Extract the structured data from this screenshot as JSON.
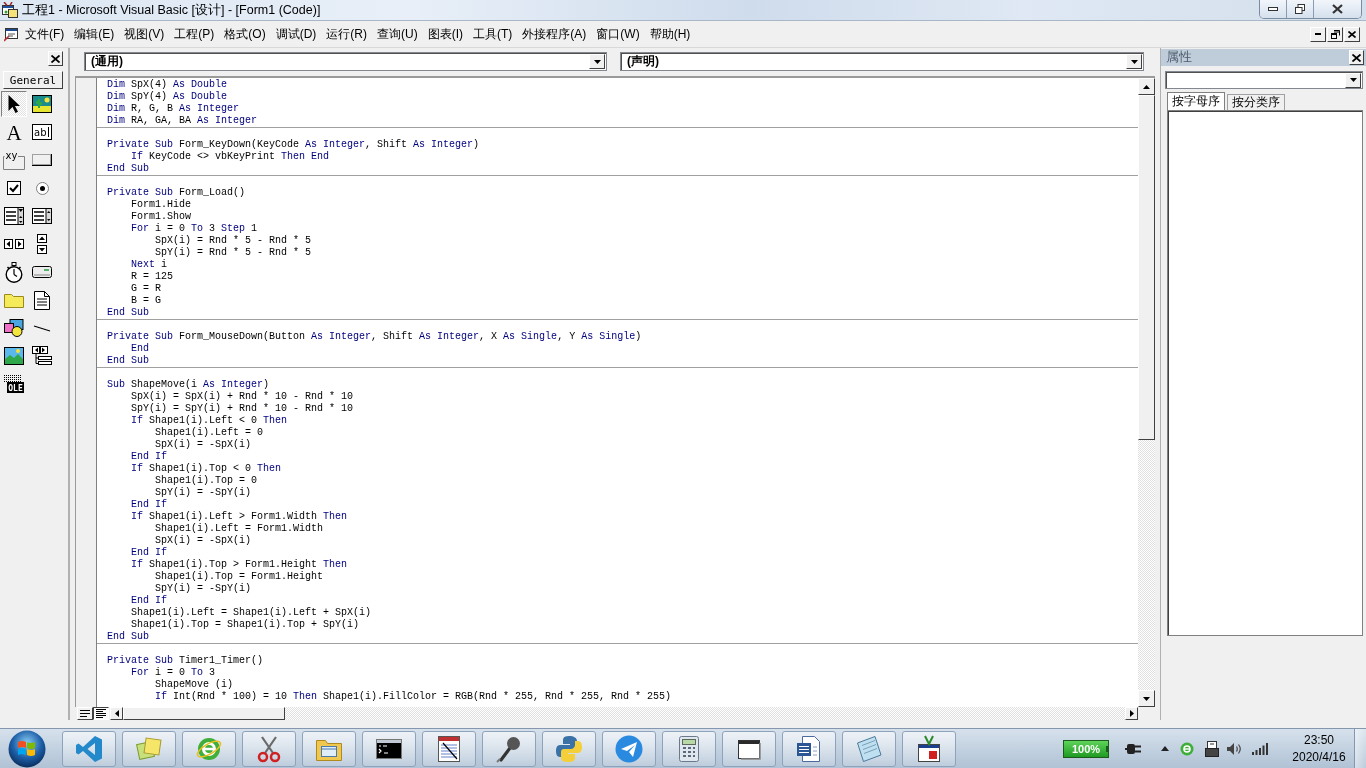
{
  "title_bar": {
    "title": "工程1 - Microsoft Visual Basic [设计] - [Form1 (Code)]"
  },
  "menu_bar": {
    "items": [
      "文件(F)",
      "编辑(E)",
      "视图(V)",
      "工程(P)",
      "格式(O)",
      "调试(D)",
      "运行(R)",
      "查询(U)",
      "图表(I)",
      "工具(T)",
      "外接程序(A)",
      "窗口(W)",
      "帮助(H)"
    ]
  },
  "toolbox": {
    "tab": "General",
    "tools": [
      {
        "kind": "pointer",
        "selected": true
      },
      {
        "kind": "picturebox",
        "selected": false
      },
      {
        "kind": "label",
        "selected": false,
        "glyph": "A"
      },
      {
        "kind": "textbox",
        "selected": false,
        "glyph": "ab"
      },
      {
        "kind": "frame",
        "selected": false,
        "glyph": "xy"
      },
      {
        "kind": "commandbutton",
        "selected": false
      },
      {
        "kind": "checkbox",
        "selected": false
      },
      {
        "kind": "optionbutton",
        "selected": false
      },
      {
        "kind": "combobox",
        "selected": false
      },
      {
        "kind": "listbox",
        "selected": false
      },
      {
        "kind": "hscroll",
        "selected": false
      },
      {
        "kind": "vscroll",
        "selected": false
      },
      {
        "kind": "timer",
        "selected": false
      },
      {
        "kind": "drivelist",
        "selected": false
      },
      {
        "kind": "dirlist",
        "selected": false
      },
      {
        "kind": "filelist",
        "selected": false
      },
      {
        "kind": "shape",
        "selected": false
      },
      {
        "kind": "line",
        "selected": false
      },
      {
        "kind": "image",
        "selected": false
      },
      {
        "kind": "data",
        "selected": false
      },
      {
        "kind": "ole",
        "selected": false,
        "glyph": "OLE"
      }
    ]
  },
  "code_window": {
    "object_box": "(通用)",
    "procedure_box": "(声明)",
    "procedures": [
      {
        "lines": [
          {
            "tokens": [
              {
                "kind": "keyword",
                "text": "Dim"
              },
              {
                "kind": "plain",
                "text": " SpX(4) "
              },
              {
                "kind": "keyword",
                "text": "As Double"
              }
            ]
          },
          {
            "tokens": [
              {
                "kind": "keyword",
                "text": "Dim"
              },
              {
                "kind": "plain",
                "text": " SpY(4) "
              },
              {
                "kind": "keyword",
                "text": "As Double"
              }
            ]
          },
          {
            "tokens": [
              {
                "kind": "keyword",
                "text": "Dim"
              },
              {
                "kind": "plain",
                "text": " R, G, B "
              },
              {
                "kind": "keyword",
                "text": "As Integer"
              }
            ]
          },
          {
            "tokens": [
              {
                "kind": "keyword",
                "text": "Dim"
              },
              {
                "kind": "plain",
                "text": " RA, GA, BA "
              },
              {
                "kind": "keyword",
                "text": "As Integer"
              }
            ]
          }
        ]
      },
      {
        "lines": [
          {
            "tokens": [
              {
                "kind": "keyword",
                "text": "Private Sub"
              },
              {
                "kind": "plain",
                "text": " Form_KeyDown(KeyCode "
              },
              {
                "kind": "keyword",
                "text": "As Integer"
              },
              {
                "kind": "plain",
                "text": ", Shift "
              },
              {
                "kind": "keyword",
                "text": "As Integer"
              },
              {
                "kind": "plain",
                "text": ")"
              }
            ],
            "children": [
              {
                "tokens": [
                  {
                    "kind": "keyword",
                    "text": "If"
                  },
                  {
                    "kind": "plain",
                    "text": " KeyCode <> vbKeyPrint "
                  },
                  {
                    "kind": "keyword",
                    "text": "Then End"
                  }
                ]
              }
            ]
          },
          {
            "tokens": [
              {
                "kind": "keyword",
                "text": "End Sub"
              }
            ]
          }
        ]
      },
      {
        "lines": [
          {
            "tokens": [
              {
                "kind": "keyword",
                "text": "Private Sub"
              },
              {
                "kind": "plain",
                "text": " Form_Load()"
              }
            ],
            "children": [
              {
                "tokens": [
                  {
                    "kind": "plain",
                    "text": "Form1.Hide"
                  }
                ]
              },
              {
                "tokens": [
                  {
                    "kind": "plain",
                    "text": "Form1.Show"
                  }
                ]
              },
              {
                "tokens": [
                  {
                    "kind": "keyword",
                    "text": "For"
                  },
                  {
                    "kind": "plain",
                    "text": " i = 0 "
                  },
                  {
                    "kind": "keyword",
                    "text": "To"
                  },
                  {
                    "kind": "plain",
                    "text": " 3 "
                  },
                  {
                    "kind": "keyword",
                    "text": "Step"
                  },
                  {
                    "kind": "plain",
                    "text": " 1"
                  }
                ],
                "children": [
                  {
                    "tokens": [
                      {
                        "kind": "plain",
                        "text": "SpX(i) = Rnd * 5 - Rnd * 5"
                      }
                    ]
                  },
                  {
                    "tokens": [
                      {
                        "kind": "plain",
                        "text": "SpY(i) = Rnd * 5 - Rnd * 5"
                      }
                    ]
                  }
                ]
              },
              {
                "tokens": [
                  {
                    "kind": "keyword",
                    "text": "Next"
                  },
                  {
                    "kind": "plain",
                    "text": " i"
                  }
                ]
              },
              {
                "tokens": [
                  {
                    "kind": "plain",
                    "text": "R = 125"
                  }
                ]
              },
              {
                "tokens": [
                  {
                    "kind": "plain",
                    "text": "G = R"
                  }
                ]
              },
              {
                "tokens": [
                  {
                    "kind": "plain",
                    "text": "B = G"
                  }
                ]
              }
            ]
          },
          {
            "tokens": [
              {
                "kind": "keyword",
                "text": "End Sub"
              }
            ]
          }
        ]
      },
      {
        "lines": [
          {
            "tokens": [
              {
                "kind": "keyword",
                "text": "Private Sub"
              },
              {
                "kind": "plain",
                "text": " Form_MouseDown(Button "
              },
              {
                "kind": "keyword",
                "text": "As Integer"
              },
              {
                "kind": "plain",
                "text": ", Shift "
              },
              {
                "kind": "keyword",
                "text": "As Integer"
              },
              {
                "kind": "plain",
                "text": ", X "
              },
              {
                "kind": "keyword",
                "text": "As Single"
              },
              {
                "kind": "plain",
                "text": ", Y "
              },
              {
                "kind": "keyword",
                "text": "As Single"
              },
              {
                "kind": "plain",
                "text": ")"
              }
            ],
            "children": [
              {
                "tokens": [
                  {
                    "kind": "keyword",
                    "text": "End"
                  }
                ]
              }
            ]
          },
          {
            "tokens": [
              {
                "kind": "keyword",
                "text": "End Sub"
              }
            ]
          }
        ]
      },
      {
        "lines": [
          {
            "tokens": [
              {
                "kind": "keyword",
                "text": "Sub"
              },
              {
                "kind": "plain",
                "text": " ShapeMove(i "
              },
              {
                "kind": "keyword",
                "text": "As Integer"
              },
              {
                "kind": "plain",
                "text": ")"
              }
            ],
            "children": [
              {
                "tokens": [
                  {
                    "kind": "plain",
                    "text": "SpX(i) = SpX(i) + Rnd * 10 - Rnd * 10"
                  }
                ]
              },
              {
                "tokens": [
                  {
                    "kind": "plain",
                    "text": "SpY(i) = SpY(i) + Rnd * 10 - Rnd * 10"
                  }
                ]
              },
              {
                "tokens": [
                  {
                    "kind": "keyword",
                    "text": "If"
                  },
                  {
                    "kind": "plain",
                    "text": " Shape1(i).Left < 0 "
                  },
                  {
                    "kind": "keyword",
                    "text": "Then"
                  }
                ],
                "children": [
                  {
                    "tokens": [
                      {
                        "kind": "plain",
                        "text": "Shape1(i).Left = 0"
                      }
                    ]
                  },
                  {
                    "tokens": [
                      {
                        "kind": "plain",
                        "text": "SpX(i) = -SpX(i)"
                      }
                    ]
                  }
                ]
              },
              {
                "tokens": [
                  {
                    "kind": "keyword",
                    "text": "End If"
                  }
                ]
              },
              {
                "tokens": [
                  {
                    "kind": "keyword",
                    "text": "If"
                  },
                  {
                    "kind": "plain",
                    "text": " Shape1(i).Top < 0 "
                  },
                  {
                    "kind": "keyword",
                    "text": "Then"
                  }
                ],
                "children": [
                  {
                    "tokens": [
                      {
                        "kind": "plain",
                        "text": "Shape1(i).Top = 0"
                      }
                    ]
                  },
                  {
                    "tokens": [
                      {
                        "kind": "plain",
                        "text": "SpY(i) = -SpY(i)"
                      }
                    ]
                  }
                ]
              },
              {
                "tokens": [
                  {
                    "kind": "keyword",
                    "text": "End If"
                  }
                ]
              },
              {
                "tokens": [
                  {
                    "kind": "keyword",
                    "text": "If"
                  },
                  {
                    "kind": "plain",
                    "text": " Shape1(i).Left > Form1.Width "
                  },
                  {
                    "kind": "keyword",
                    "text": "Then"
                  }
                ],
                "children": [
                  {
                    "tokens": [
                      {
                        "kind": "plain",
                        "text": "Shape1(i).Left = Form1.Width"
                      }
                    ]
                  },
                  {
                    "tokens": [
                      {
                        "kind": "plain",
                        "text": "SpX(i) = -SpX(i)"
                      }
                    ]
                  }
                ]
              },
              {
                "tokens": [
                  {
                    "kind": "keyword",
                    "text": "End If"
                  }
                ]
              },
              {
                "tokens": [
                  {
                    "kind": "keyword",
                    "text": "If"
                  },
                  {
                    "kind": "plain",
                    "text": " Shape1(i).Top > Form1.Height "
                  },
                  {
                    "kind": "keyword",
                    "text": "Then"
                  }
                ],
                "children": [
                  {
                    "tokens": [
                      {
                        "kind": "plain",
                        "text": "Shape1(i).Top = Form1.Height"
                      }
                    ]
                  },
                  {
                    "tokens": [
                      {
                        "kind": "plain",
                        "text": "SpY(i) = -SpY(i)"
                      }
                    ]
                  }
                ]
              },
              {
                "tokens": [
                  {
                    "kind": "keyword",
                    "text": "End If"
                  }
                ]
              },
              {
                "tokens": [
                  {
                    "kind": "plain",
                    "text": "Shape1(i).Left = Shape1(i).Left + SpX(i)"
                  }
                ]
              },
              {
                "tokens": [
                  {
                    "kind": "plain",
                    "text": "Shape1(i).Top = Shape1(i).Top + SpY(i)"
                  }
                ]
              }
            ]
          },
          {
            "tokens": [
              {
                "kind": "keyword",
                "text": "End Sub"
              }
            ]
          }
        ]
      },
      {
        "lines": [
          {
            "tokens": [
              {
                "kind": "keyword",
                "text": "Private Sub"
              },
              {
                "kind": "plain",
                "text": " Timer1_Timer()"
              }
            ],
            "children": [
              {
                "tokens": [
                  {
                    "kind": "keyword",
                    "text": "For"
                  },
                  {
                    "kind": "plain",
                    "text": " i = 0 "
                  },
                  {
                    "kind": "keyword",
                    "text": "To"
                  },
                  {
                    "kind": "plain",
                    "text": " 3"
                  }
                ],
                "children": [
                  {
                    "tokens": [
                      {
                        "kind": "plain",
                        "text": "ShapeMove (i)"
                      }
                    ]
                  },
                  {
                    "tokens": [
                      {
                        "kind": "keyword",
                        "text": "If"
                      },
                      {
                        "kind": "plain",
                        "text": " Int(Rnd * 100) = 10 "
                      },
                      {
                        "kind": "keyword",
                        "text": "Then"
                      },
                      {
                        "kind": "plain",
                        "text": " Shape1(i).FillColor = RGB(Rnd * 255, Rnd * 255, Rnd * 255)"
                      }
                    ]
                  }
                ]
              }
            ]
          }
        ]
      }
    ],
    "view_buttons": [
      {
        "kind": "procedure",
        "selected": false
      },
      {
        "kind": "module",
        "selected": true
      }
    ]
  },
  "properties": {
    "title": "属性",
    "tabs": [
      {
        "label": "按字母序",
        "selected": true
      },
      {
        "label": "按分类序",
        "selected": false
      }
    ]
  },
  "taskbar": {
    "battery": "100%",
    "time": "23:50",
    "date": "2020/4/16"
  }
}
